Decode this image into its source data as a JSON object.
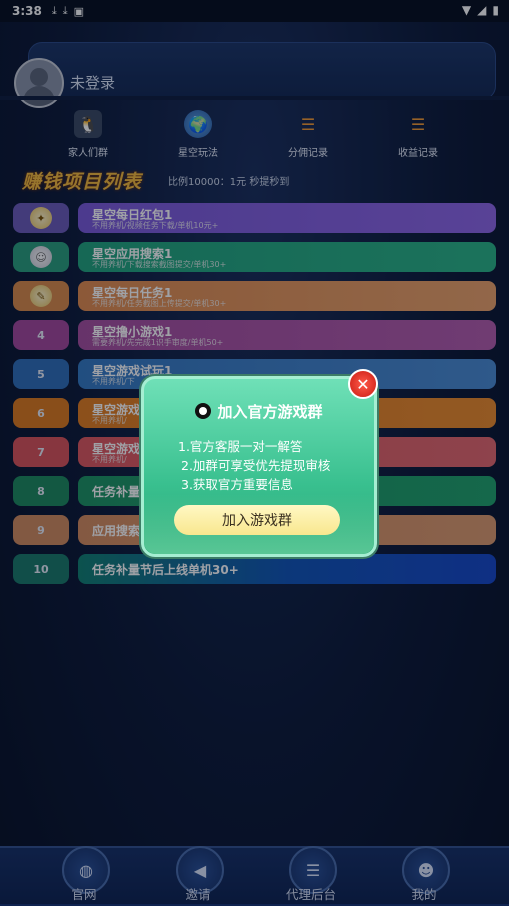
{
  "status_bar": {
    "time": "3:38"
  },
  "header": {
    "login_text": "未登录"
  },
  "quick_nav": [
    {
      "label": "家人们群",
      "icon": "penguin-icon"
    },
    {
      "label": "星空玩法",
      "icon": "globe-icon"
    },
    {
      "label": "分佣记录",
      "icon": "clock-list-icon"
    },
    {
      "label": "收益记录",
      "icon": "clock-list-icon"
    }
  ],
  "section": {
    "title": "赚钱项目列表",
    "subtitle": "比例10000：1元  秒提秒到"
  },
  "tasks": [
    {
      "num": "",
      "title": "星空每日红包1",
      "desc": "不用养机/视频任务下载/单机10元+"
    },
    {
      "num": "",
      "title": "星空应用搜索1",
      "desc": "不用养机/下载搜索截图提交/单机30+"
    },
    {
      "num": "",
      "title": "星空每日任务1",
      "desc": "不用养机/任务截图上传提交/单机30+"
    },
    {
      "num": "4",
      "title": "星空撸小游戏1",
      "desc": "需要养机/先完成1识手审度/单机50+"
    },
    {
      "num": "5",
      "title": "星空游戏试玩1",
      "desc": "不用养机/下"
    },
    {
      "num": "6",
      "title": "星空游戏",
      "desc": "不用养机/"
    },
    {
      "num": "7",
      "title": "星空游戏",
      "desc": "不用养机/"
    },
    {
      "num": "8",
      "title": "任务补量",
      "desc": ""
    },
    {
      "num": "9",
      "title": "应用搜索",
      "desc": ""
    },
    {
      "num": "10",
      "title": "任务补量节后上线单机30+",
      "desc": ""
    }
  ],
  "dialog": {
    "title": "加入官方游戏群",
    "lines": [
      "1.官方客服一对一解答",
      "2.加群可享受优先提现审核",
      "3.获取官方重要信息"
    ],
    "button": "加入游戏群"
  },
  "bottom_nav": [
    {
      "label": "官网",
      "icon": "globe-icon"
    },
    {
      "label": "邀请",
      "icon": "megaphone-icon"
    },
    {
      "label": "代理后台",
      "icon": "document-icon"
    },
    {
      "label": "我的",
      "icon": "user-icon"
    }
  ]
}
